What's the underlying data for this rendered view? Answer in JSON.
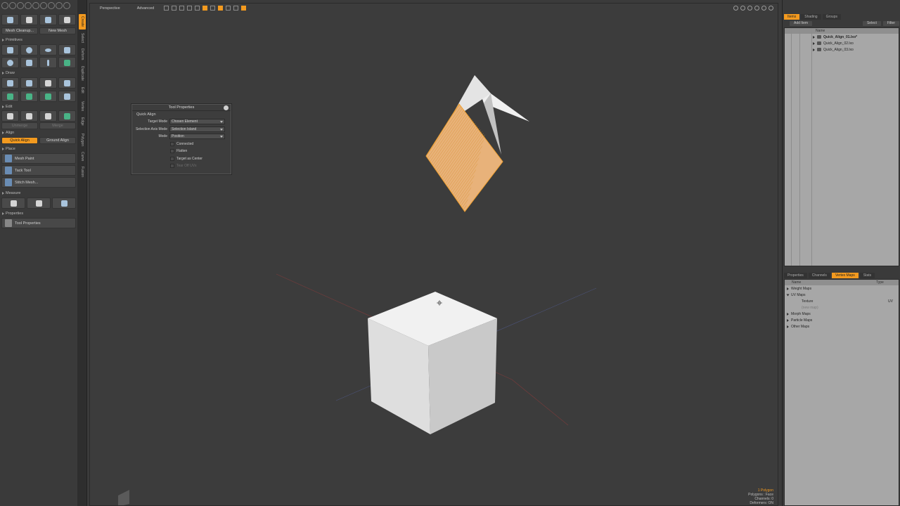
{
  "toolbox": {
    "buttons": {
      "mesh_cleanup": "Mesh Cleanup...",
      "new_mesh": "New Mesh",
      "unmerge": "Unmerge",
      "merge": "Merge",
      "quick_align": "Quick Align",
      "ground_align": "Ground Align",
      "mesh_paint": "Mesh Paint",
      "tack_tool": "Tack Tool",
      "stitch_mesh": "Stitch Mesh...",
      "tool_properties": "Tool Properties"
    },
    "sections": {
      "primitives": "Primitives",
      "draw": "Draw",
      "edit": "Edit",
      "align": "Align",
      "place": "Place",
      "measure": "Measure",
      "properties": "Properties"
    }
  },
  "vertical_tabs": [
    "Create",
    "Select",
    "Deform",
    "Duplicate",
    "Edit",
    "Vertex",
    "Edge",
    "Polygon",
    "Curve",
    "Fusion"
  ],
  "viewport": {
    "view_mode": "Perspective",
    "shading_mode": "Advanced",
    "status": {
      "line1": "1 Polygon",
      "line2": "Polygons : Face",
      "line3": "Channels: 0",
      "line4": "Deformers: ON"
    }
  },
  "tool_properties": {
    "title": "Tool Properties",
    "group": "Quick Align",
    "fields": [
      {
        "label": "Target Mode",
        "value": "Chosen Element"
      },
      {
        "label": "Selection Axis Mode",
        "value": "Selection Island"
      },
      {
        "label": "Mode",
        "value": "Position"
      }
    ],
    "checkboxes": {
      "connected": "Connected",
      "flatten": "Flatten",
      "target_as_center": "Target as Center",
      "tear_off_uvs": "Tear Off UVs"
    }
  },
  "items_panel": {
    "tabs": [
      "Items",
      "Shading",
      "Groups"
    ],
    "add_item": "Add Item",
    "select": "Select",
    "filter": "Filter",
    "column_name": "Name",
    "items": [
      {
        "name": "Quick_Align_01.lxo*"
      },
      {
        "name": "Quick_Align_02.lxo"
      },
      {
        "name": "Quick_Align_03.lxo"
      }
    ]
  },
  "vmaps_panel": {
    "tabs": [
      "Properties",
      "Channels",
      "Vertex Maps",
      "Stats"
    ],
    "column_name": "Name",
    "column_type": "Type",
    "rows": {
      "weight_maps": "Weight Maps",
      "uv_maps": "UV Maps",
      "texture": "Texture",
      "texture_type": "UV",
      "new_map": "(new map)",
      "morph_maps": "Morph Maps",
      "particle_maps": "Particle Maps",
      "other_maps": "Other Maps"
    }
  },
  "colors": {
    "accent": "#f39a1f",
    "viewport_bg": "#3c3c3c",
    "panel_bg": "#a7a7a7"
  }
}
